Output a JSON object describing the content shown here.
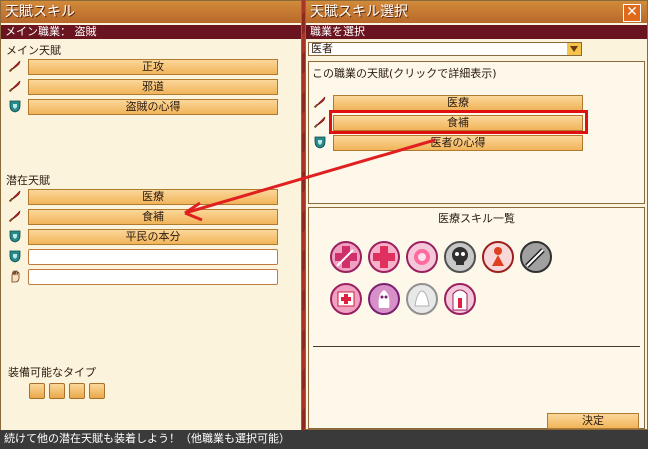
{
  "left_window": {
    "title": "天賦スキル",
    "main_job_label": "メイン職業：",
    "main_job_value": "盗賊",
    "main_talent_heading": "メイン天賦",
    "main_talents": [
      "正攻",
      "邪道",
      "盗賊の心得"
    ],
    "latent_heading": "潜在天賦",
    "latent_talents": [
      "医療",
      "食補",
      "平民の本分",
      "",
      ""
    ],
    "equip_types_heading": "装備可能なタイプ"
  },
  "right_window": {
    "title": "天賦スキル選択",
    "job_select_label": "職業を選択",
    "job_select_value": "医者",
    "job_talents_heading": "この職業の天賦(クリックで詳細表示)",
    "job_talents": [
      "医療",
      "食補",
      "医者の心得"
    ],
    "skill_list_heading": "医療スキル一覧",
    "confirm_label": "決定",
    "close_label": "✕"
  },
  "footer": {
    "hint": "続けて他の潜在天賦も装着しよう！（他職業も選択可能）"
  },
  "colors": {
    "title_bar": "#c97a32",
    "sub_bar": "#6a1420",
    "button_fill": "#f1b45a",
    "highlight": "#e01010",
    "arrow": "#e02020"
  },
  "icons": {
    "sword": "sword-icon",
    "shield": "shield-icon",
    "hand": "hand-icon"
  }
}
